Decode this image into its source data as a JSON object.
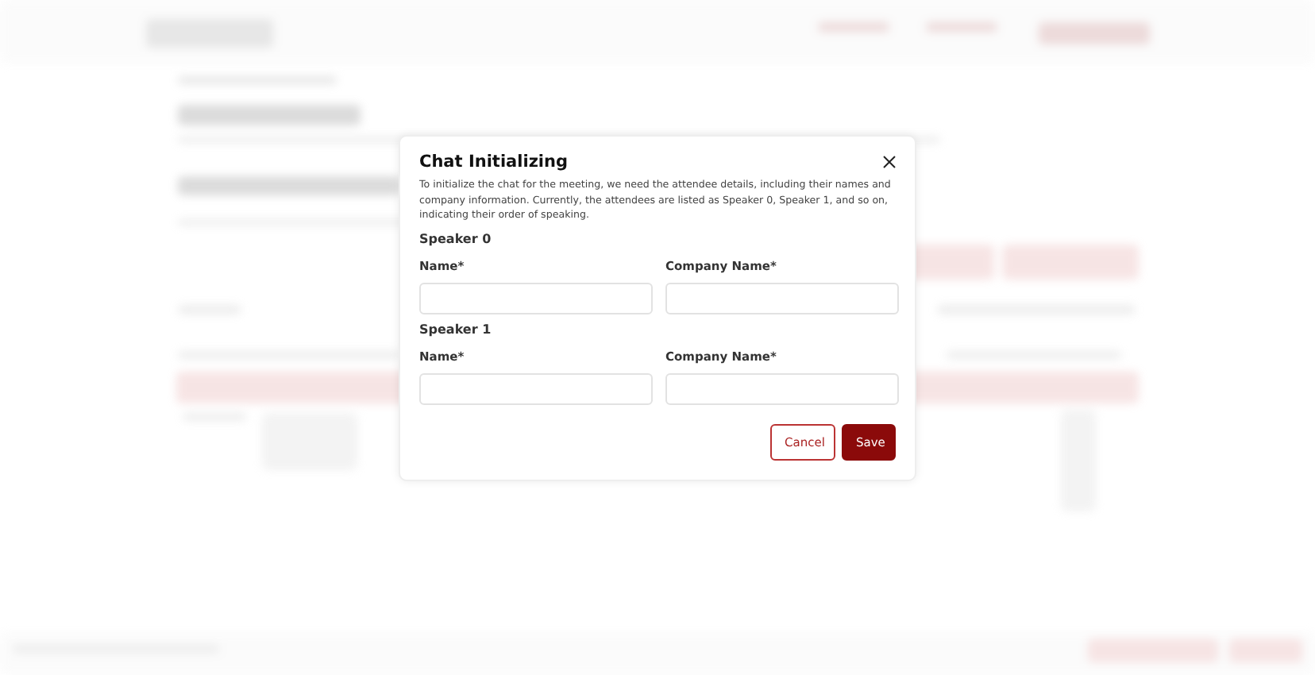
{
  "dialog": {
    "title": "Chat Initializing",
    "description": "To initialize the chat for the meeting, we need the attendee details, including their names and company information. Currently, the attendees are listed as Speaker 0, Speaker 1, and so on, indicating their order of speaking.",
    "speakers": [
      {
        "heading": "Speaker 0",
        "fields": [
          {
            "label": "Name*"
          },
          {
            "label": "Company Name*"
          }
        ]
      },
      {
        "heading": "Speaker 1",
        "fields": [
          {
            "label": "Name*"
          },
          {
            "label": "Company Name*"
          }
        ]
      }
    ],
    "buttons": [
      {
        "label": "Cancel",
        "kind": "secondary"
      },
      {
        "label": "Save",
        "kind": "primary"
      }
    ]
  }
}
